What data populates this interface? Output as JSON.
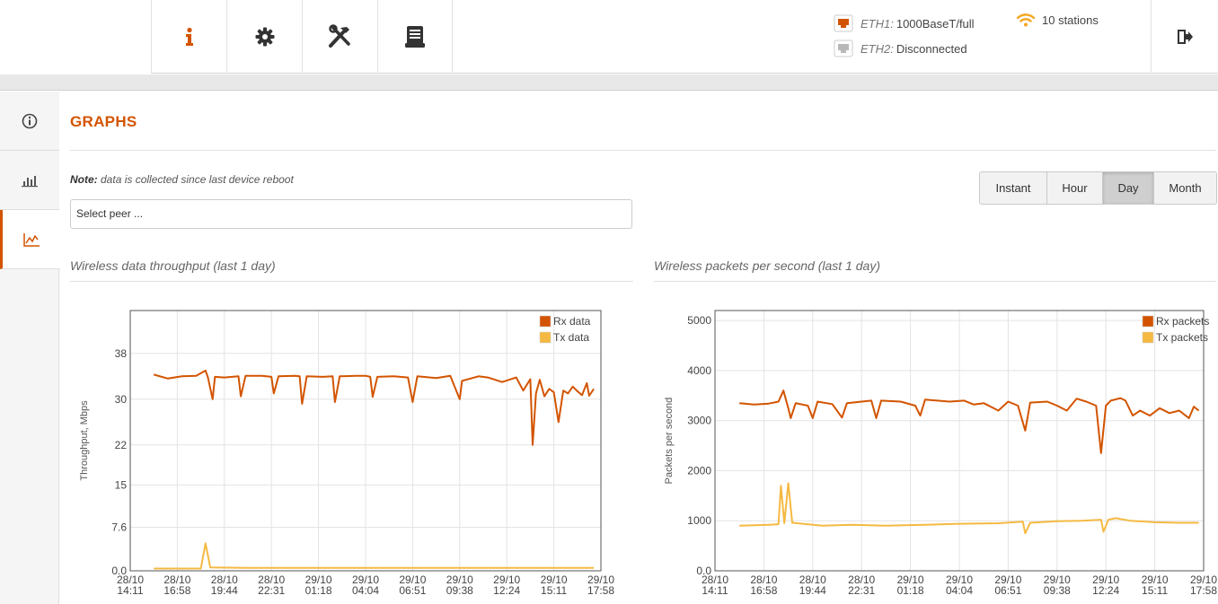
{
  "topbar": {
    "nav_items": [
      {
        "name": "info-icon"
      },
      {
        "name": "gear-icon"
      },
      {
        "name": "tools-icon"
      },
      {
        "name": "router-icon"
      }
    ],
    "eth1": {
      "label": "ETH1:",
      "value": "1000BaseT/full",
      "color": "#d35400"
    },
    "eth2": {
      "label": "ETH2:",
      "value": "Disconnected",
      "color": "#b8b8b8"
    },
    "stations": "10 stations",
    "logout_icon": "logout-icon"
  },
  "sidebar": {
    "items": [
      {
        "name": "status-icon"
      },
      {
        "name": "stats-bar-icon"
      },
      {
        "name": "graph-line-icon",
        "active": true
      }
    ]
  },
  "page": {
    "title": "GRAPHS",
    "note_bold": "Note:",
    "note_text": " data is collected since last device reboot",
    "peer_placeholder": "Select peer ...",
    "periods": [
      "Instant",
      "Hour",
      "Day",
      "Month"
    ],
    "active_period": "Day"
  },
  "colors": {
    "accent": "#d35400",
    "rx": "#d35400",
    "tx": "#f5b942"
  },
  "chart_data": [
    {
      "type": "line",
      "title": "Wireless data throughput (last 1 day)",
      "ylabel": "Throughput, Mbps",
      "xlabel": "",
      "ylim": [
        0,
        45.5
      ],
      "yticks": [
        0.0,
        7.6,
        15,
        22,
        30,
        38
      ],
      "ytick_labels": [
        "0.0",
        "7.6",
        "15",
        "22",
        "30",
        "38"
      ],
      "x_tick_labels": [
        [
          "28/10",
          "14:11"
        ],
        [
          "28/10",
          "16:58"
        ],
        [
          "28/10",
          "19:44"
        ],
        [
          "28/10",
          "22:31"
        ],
        [
          "29/10",
          "01:18"
        ],
        [
          "29/10",
          "04:04"
        ],
        [
          "29/10",
          "06:51"
        ],
        [
          "29/10",
          "09:38"
        ],
        [
          "29/10",
          "12:24"
        ],
        [
          "29/10",
          "15:11"
        ],
        [
          "29/10",
          "17:58"
        ]
      ],
      "x_range": [
        0,
        10
      ],
      "grid": true,
      "legend": "top-right",
      "series": [
        {
          "name": "Rx data",
          "color": "#d35400",
          "points": [
            [
              0.5,
              34.3
            ],
            [
              0.8,
              33.6
            ],
            [
              1.1,
              34.0
            ],
            [
              1.4,
              34.1
            ],
            [
              1.6,
              35.0
            ],
            [
              1.65,
              33.8
            ],
            [
              1.75,
              30.0
            ],
            [
              1.8,
              33.9
            ],
            [
              2.0,
              33.8
            ],
            [
              2.3,
              34.0
            ],
            [
              2.35,
              30.5
            ],
            [
              2.45,
              34.1
            ],
            [
              2.8,
              34.1
            ],
            [
              3.0,
              33.9
            ],
            [
              3.05,
              31.0
            ],
            [
              3.15,
              34.0
            ],
            [
              3.5,
              34.1
            ],
            [
              3.6,
              34.0
            ],
            [
              3.65,
              29.2
            ],
            [
              3.75,
              34.0
            ],
            [
              4.1,
              33.9
            ],
            [
              4.3,
              34.0
            ],
            [
              4.35,
              29.5
            ],
            [
              4.45,
              34.0
            ],
            [
              4.8,
              34.1
            ],
            [
              5.0,
              34.1
            ],
            [
              5.1,
              33.9
            ],
            [
              5.15,
              30.4
            ],
            [
              5.25,
              33.9
            ],
            [
              5.6,
              34.0
            ],
            [
              5.9,
              33.8
            ],
            [
              6.0,
              29.5
            ],
            [
              6.1,
              34.0
            ],
            [
              6.5,
              33.7
            ],
            [
              6.8,
              34.1
            ],
            [
              6.95,
              31.0
            ],
            [
              7.0,
              30.0
            ],
            [
              7.05,
              33.2
            ],
            [
              7.4,
              34.0
            ],
            [
              7.6,
              33.8
            ],
            [
              7.9,
              33.0
            ],
            [
              8.2,
              33.8
            ],
            [
              8.35,
              31.5
            ],
            [
              8.5,
              33.5
            ],
            [
              8.55,
              22.0
            ],
            [
              8.62,
              31.0
            ],
            [
              8.7,
              33.4
            ],
            [
              8.8,
              30.5
            ],
            [
              8.9,
              31.8
            ],
            [
              9.0,
              31.2
            ],
            [
              9.1,
              26.0
            ],
            [
              9.2,
              31.5
            ],
            [
              9.3,
              31.0
            ],
            [
              9.4,
              32.2
            ],
            [
              9.5,
              31.4
            ],
            [
              9.6,
              30.7
            ],
            [
              9.7,
              32.8
            ],
            [
              9.75,
              30.6
            ],
            [
              9.85,
              31.8
            ]
          ]
        },
        {
          "name": "Tx data",
          "color": "#f5b942",
          "points": [
            [
              0.5,
              0.4
            ],
            [
              1.5,
              0.4
            ],
            [
              1.6,
              4.8
            ],
            [
              1.7,
              0.6
            ],
            [
              2.5,
              0.5
            ],
            [
              5.0,
              0.5
            ],
            [
              7.5,
              0.5
            ],
            [
              9.85,
              0.5
            ]
          ]
        }
      ]
    },
    {
      "type": "line",
      "title": "Wireless packets per second (last 1 day)",
      "ylabel": "Packets per second",
      "xlabel": "",
      "ylim": [
        0,
        5200
      ],
      "yticks": [
        0,
        1000,
        2000,
        3000,
        4000,
        5000
      ],
      "ytick_labels": [
        "0.0",
        "1000",
        "2000",
        "3000",
        "4000",
        "5000"
      ],
      "x_tick_labels": [
        [
          "28/10",
          "14:11"
        ],
        [
          "28/10",
          "16:58"
        ],
        [
          "28/10",
          "19:44"
        ],
        [
          "28/10",
          "22:31"
        ],
        [
          "29/10",
          "01:18"
        ],
        [
          "29/10",
          "04:04"
        ],
        [
          "29/10",
          "06:51"
        ],
        [
          "29/10",
          "09:38"
        ],
        [
          "29/10",
          "12:24"
        ],
        [
          "29/10",
          "15:11"
        ],
        [
          "29/10",
          "17:58"
        ]
      ],
      "x_range": [
        0,
        10
      ],
      "grid": true,
      "legend": "top-right",
      "series": [
        {
          "name": "Rx packets",
          "color": "#d35400",
          "points": [
            [
              0.5,
              3350
            ],
            [
              0.8,
              3320
            ],
            [
              1.1,
              3340
            ],
            [
              1.3,
              3380
            ],
            [
              1.4,
              3600
            ],
            [
              1.5,
              3250
            ],
            [
              1.55,
              3050
            ],
            [
              1.65,
              3350
            ],
            [
              1.9,
              3300
            ],
            [
              2.0,
              3050
            ],
            [
              2.1,
              3380
            ],
            [
              2.4,
              3330
            ],
            [
              2.6,
              3060
            ],
            [
              2.7,
              3350
            ],
            [
              3.0,
              3380
            ],
            [
              3.2,
              3400
            ],
            [
              3.3,
              3050
            ],
            [
              3.4,
              3400
            ],
            [
              3.8,
              3380
            ],
            [
              4.1,
              3300
            ],
            [
              4.2,
              3100
            ],
            [
              4.3,
              3420
            ],
            [
              4.8,
              3380
            ],
            [
              5.1,
              3400
            ],
            [
              5.3,
              3320
            ],
            [
              5.5,
              3350
            ],
            [
              5.8,
              3200
            ],
            [
              6.0,
              3380
            ],
            [
              6.2,
              3300
            ],
            [
              6.35,
              2800
            ],
            [
              6.45,
              3360
            ],
            [
              6.8,
              3380
            ],
            [
              7.0,
              3300
            ],
            [
              7.2,
              3200
            ],
            [
              7.4,
              3440
            ],
            [
              7.6,
              3380
            ],
            [
              7.8,
              3300
            ],
            [
              7.9,
              2350
            ],
            [
              8.0,
              3300
            ],
            [
              8.1,
              3400
            ],
            [
              8.3,
              3450
            ],
            [
              8.4,
              3400
            ],
            [
              8.55,
              3100
            ],
            [
              8.7,
              3200
            ],
            [
              8.9,
              3100
            ],
            [
              9.1,
              3250
            ],
            [
              9.3,
              3150
            ],
            [
              9.5,
              3200
            ],
            [
              9.7,
              3050
            ],
            [
              9.8,
              3280
            ],
            [
              9.9,
              3200
            ]
          ]
        },
        {
          "name": "Tx packets",
          "color": "#f5b942",
          "points": [
            [
              0.5,
              900
            ],
            [
              1.1,
              920
            ],
            [
              1.3,
              930
            ],
            [
              1.35,
              1700
            ],
            [
              1.42,
              950
            ],
            [
              1.5,
              1750
            ],
            [
              1.58,
              960
            ],
            [
              1.8,
              940
            ],
            [
              2.2,
              900
            ],
            [
              2.8,
              920
            ],
            [
              3.5,
              900
            ],
            [
              4.3,
              920
            ],
            [
              5.0,
              940
            ],
            [
              5.8,
              950
            ],
            [
              6.3,
              980
            ],
            [
              6.35,
              750
            ],
            [
              6.45,
              960
            ],
            [
              7.0,
              990
            ],
            [
              7.5,
              1000
            ],
            [
              7.9,
              1020
            ],
            [
              7.95,
              780
            ],
            [
              8.05,
              1020
            ],
            [
              8.2,
              1050
            ],
            [
              8.5,
              1000
            ],
            [
              9.0,
              970
            ],
            [
              9.5,
              960
            ],
            [
              9.9,
              960
            ]
          ]
        }
      ]
    }
  ]
}
